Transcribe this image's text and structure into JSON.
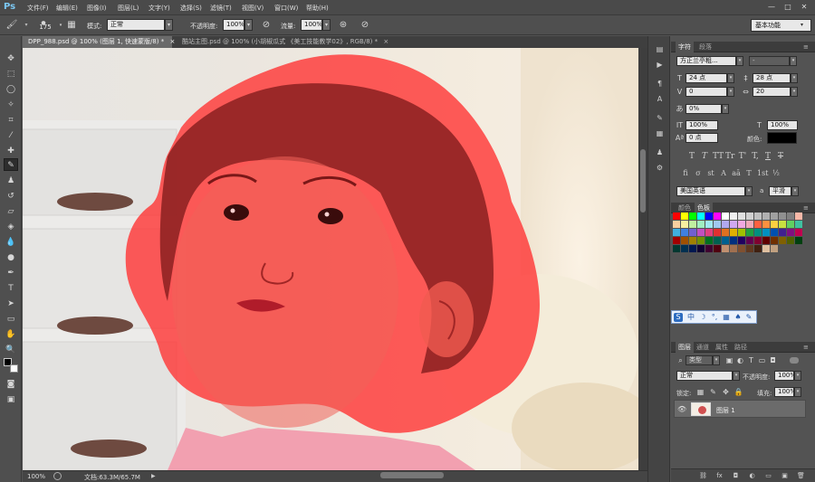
{
  "app": {
    "logo": "Ps"
  },
  "menu": [
    "文件(F)",
    "编辑(E)",
    "图像(I)",
    "图层(L)",
    "文字(Y)",
    "选择(S)",
    "滤镜(T)",
    "视图(V)",
    "窗口(W)",
    "帮助(H)"
  ],
  "window_controls": [
    "—",
    "□",
    "✕"
  ],
  "options": {
    "brush_size": "175",
    "mode_label": "模式:",
    "mode_value": "正常",
    "opacity_label": "不透明度:",
    "opacity_value": "100%",
    "flow_label": "流量:",
    "flow_value": "100%",
    "workspace": "基本功能"
  },
  "doc_tabs": [
    {
      "label": "DPP_988.psd @ 100% (图层 1, 快速蒙版/8) *",
      "close": "×"
    },
    {
      "label": "酷站主图.psd @ 100% (小胡椒瓜式 《美工技能教学02》, RGB/8) *",
      "close": "×"
    }
  ],
  "status": {
    "zoom": "100%",
    "doc_size": "文档:63.3M/65.7M"
  },
  "character_panel": {
    "tabs": [
      "字符",
      "段落"
    ],
    "font_family": "方正兰亭粗...",
    "font_style": "-",
    "font_size": "24 点",
    "leading": "28 点",
    "kerning": "0",
    "tracking": "20",
    "scale_pct": "0%",
    "vscale": "100%",
    "hscale": "100%",
    "baseline": "0 点",
    "color_label": "颜色:",
    "text_color": "#000000",
    "language": "美国英语",
    "antialias": "平滑",
    "text_styles": [
      "T",
      "T",
      "TT",
      "Tr",
      "T'",
      "T,",
      "T",
      "T"
    ],
    "aa_label": "a"
  },
  "swatches_panel": {
    "tabs": [
      "颜色",
      "色板"
    ],
    "colors": [
      "#ff0000",
      "#ffff00",
      "#00ff00",
      "#00ffff",
      "#0000ff",
      "#ff00ff",
      "#ffffff",
      "#f0f0f0",
      "#e0e0e0",
      "#d0d0d0",
      "#c0c0c0",
      "#b0b0b0",
      "#a0a0a0",
      "#909090",
      "#808080",
      "#f8b8a8",
      "#f8d0a0",
      "#f8f0a0",
      "#c0f0a0",
      "#a0f0c0",
      "#a0e8f0",
      "#a0c8f0",
      "#b0a8f0",
      "#d0a8f0",
      "#f0a8e0",
      "#f0a8b8",
      "#ff6040",
      "#ff9040",
      "#ffd040",
      "#c8e040",
      "#60d060",
      "#40c0a0",
      "#40b0e0",
      "#4080e0",
      "#7060d0",
      "#c050c0",
      "#e04080",
      "#e03030",
      "#e07020",
      "#e0b000",
      "#a0c000",
      "#20a040",
      "#009080",
      "#0090c0",
      "#0050b0",
      "#402090",
      "#801080",
      "#c00050",
      "#a00000",
      "#a05000",
      "#a08000",
      "#709000",
      "#007020",
      "#006050",
      "#006090",
      "#003080",
      "#200060",
      "#600050",
      "#800030",
      "#600000",
      "#703000",
      "#806000",
      "#506000",
      "#004010",
      "#003830",
      "#003050",
      "#001850",
      "#100030",
      "#400030",
      "#500010",
      "#c09070",
      "#a07050",
      "#805030",
      "#603820",
      "#402010",
      "#e0c0a0",
      "#c0a080"
    ]
  },
  "ime": {
    "logo": "S",
    "mode": "中",
    "items": [
      "☽",
      "°,",
      "▦",
      "♠",
      "✎"
    ]
  },
  "layers_panel": {
    "tabs": [
      "图层",
      "通道",
      "属性",
      "路径"
    ],
    "filter": "类型",
    "blend_mode": "正常",
    "opacity_label": "不透明度:",
    "opacity": "100%",
    "lock_label": "锁定:",
    "fill_label": "填充:",
    "fill": "100%",
    "layer_name": "图层 1",
    "footer_icons": [
      "⛓",
      "fx",
      "◘",
      "◐",
      "▭",
      "▣",
      "🗑"
    ]
  },
  "colors": {
    "quickmask_overlay": "#ff3030",
    "ps_blue": "#7cc8f4"
  }
}
